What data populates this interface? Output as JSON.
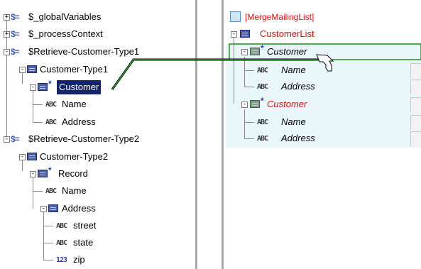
{
  "source_tree": {
    "items": [
      {
        "label": "$_globalVariables"
      },
      {
        "label": "$_processContext"
      },
      {
        "label": "$Retrieve-Customer-Type1"
      },
      {
        "label": "Customer-Type1"
      },
      {
        "label": "Customer"
      },
      {
        "label": "Name"
      },
      {
        "label": "Address"
      },
      {
        "label": "$Retrieve-Customer-Type2"
      },
      {
        "label": "Customer-Type2"
      },
      {
        "label": "Record"
      },
      {
        "label": "Name"
      },
      {
        "label": "Address"
      },
      {
        "label": "street"
      },
      {
        "label": "state"
      },
      {
        "label": "zip"
      }
    ]
  },
  "target_tree": {
    "root_label": "[MergeMailingList]",
    "items": [
      {
        "label": "CustomerList"
      },
      {
        "label": "Customer"
      },
      {
        "label": "Name"
      },
      {
        "label": "Address"
      },
      {
        "label": "Customer"
      },
      {
        "label": "Name"
      },
      {
        "label": "Address"
      }
    ]
  },
  "icons": {
    "variable": "$=",
    "string": "ABC",
    "number": "123",
    "repeat_marker": "*",
    "expand": "+",
    "collapse": "-"
  },
  "colors": {
    "selection": "#14246b",
    "required_text": "#e01010",
    "mapping_line": "#1f8f1f",
    "target_band": "#e9f7fb"
  }
}
